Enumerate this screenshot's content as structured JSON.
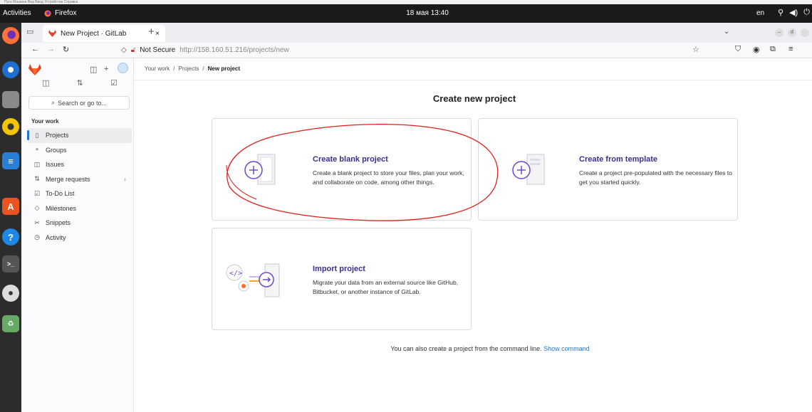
{
  "vm_menu": "Пуск   Машина   Вид   Ввод   Устройства   Справка",
  "topbar": {
    "activities": "Activities",
    "app_name": "Firefox",
    "clock": "18 мая 13:40",
    "lang": "en"
  },
  "browser": {
    "tab_title": "New Project · GitLab",
    "tab_close": "×",
    "new_tab": "+",
    "security_label": "Not Secure",
    "url": "http://158.160.51.216/projects/new"
  },
  "sidebar": {
    "search_placeholder": "Search or go to...",
    "section_title": "Your work",
    "items": [
      {
        "label": "Projects",
        "icon": "project-icon"
      },
      {
        "label": "Groups",
        "icon": "group-icon"
      },
      {
        "label": "Issues",
        "icon": "issue-icon"
      },
      {
        "label": "Merge requests",
        "icon": "merge-request-icon"
      },
      {
        "label": "To-Do List",
        "icon": "todo-icon"
      },
      {
        "label": "Milestones",
        "icon": "milestone-icon"
      },
      {
        "label": "Snippets",
        "icon": "snippet-icon"
      },
      {
        "label": "Activity",
        "icon": "activity-icon"
      }
    ]
  },
  "breadcrumb": [
    "Your work",
    "Projects",
    "New project"
  ],
  "breadcrumb_sep": "/",
  "page": {
    "title": "Create new project",
    "cards": {
      "blank": {
        "title": "Create blank project",
        "desc": "Create a blank project to store your files, plan your work, and collaborate on code, among other things."
      },
      "template": {
        "title": "Create from template",
        "desc": "Create a project pre-populated with the necessary files to get you started quickly."
      },
      "import": {
        "title": "Import project",
        "desc": "Migrate your data from an external source like GitHub, Bitbucket, or another instance of GitLab."
      }
    },
    "cli_text": "You can also create a project from the command line.",
    "cli_link": "Show command"
  },
  "colors": {
    "accent": "#1f75cb",
    "card_title": "#3a2f8c",
    "annotation": "#e0201c",
    "gitlab_orange": "#e24329"
  }
}
